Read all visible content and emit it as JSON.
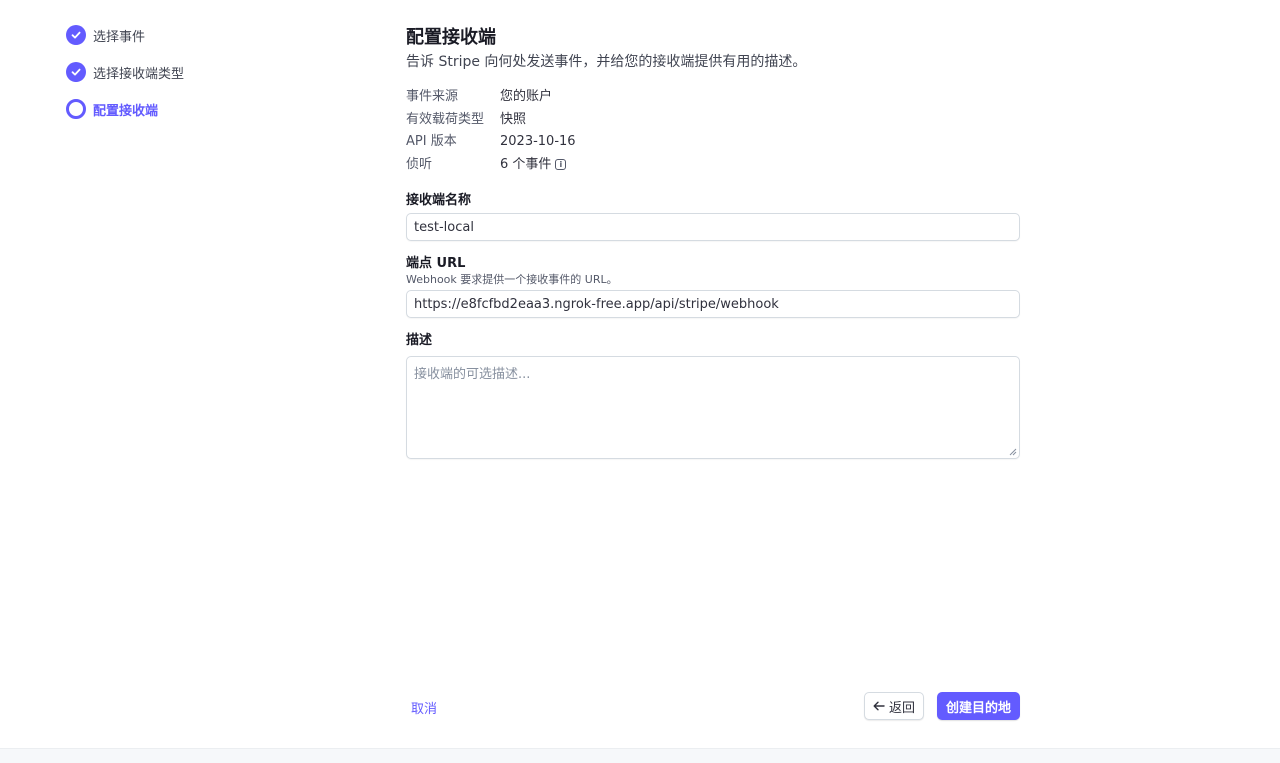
{
  "steps": [
    {
      "label": "选择事件",
      "state": "done"
    },
    {
      "label": "选择接收端类型",
      "state": "done"
    },
    {
      "label": "配置接收端",
      "state": "active"
    }
  ],
  "header": {
    "title": "配置接收端",
    "subtitle": "告诉 Stripe 向何处发送事件，并给您的接收端提供有用的描述。"
  },
  "meta": [
    {
      "key": "事件来源",
      "value": "您的账户"
    },
    {
      "key": "有效载荷类型",
      "value": "快照"
    },
    {
      "key": "API 版本",
      "value": "2023-10-16"
    },
    {
      "key": "侦听",
      "value": "6 个事件"
    }
  ],
  "form": {
    "name_label": "接收端名称",
    "name_value": "test-local",
    "url_label": "端点 URL",
    "url_help": "Webhook 要求提供一个接收事件的 URL。",
    "url_value": "https://e8fcfbd2eaa3.ngrok-free.app/api/stripe/webhook",
    "desc_label": "描述",
    "desc_placeholder": "接收端的可选描述..."
  },
  "actions": {
    "cancel": "取消",
    "back": "返回",
    "create": "创建目的地"
  },
  "colors": {
    "accent": "#635bff"
  }
}
